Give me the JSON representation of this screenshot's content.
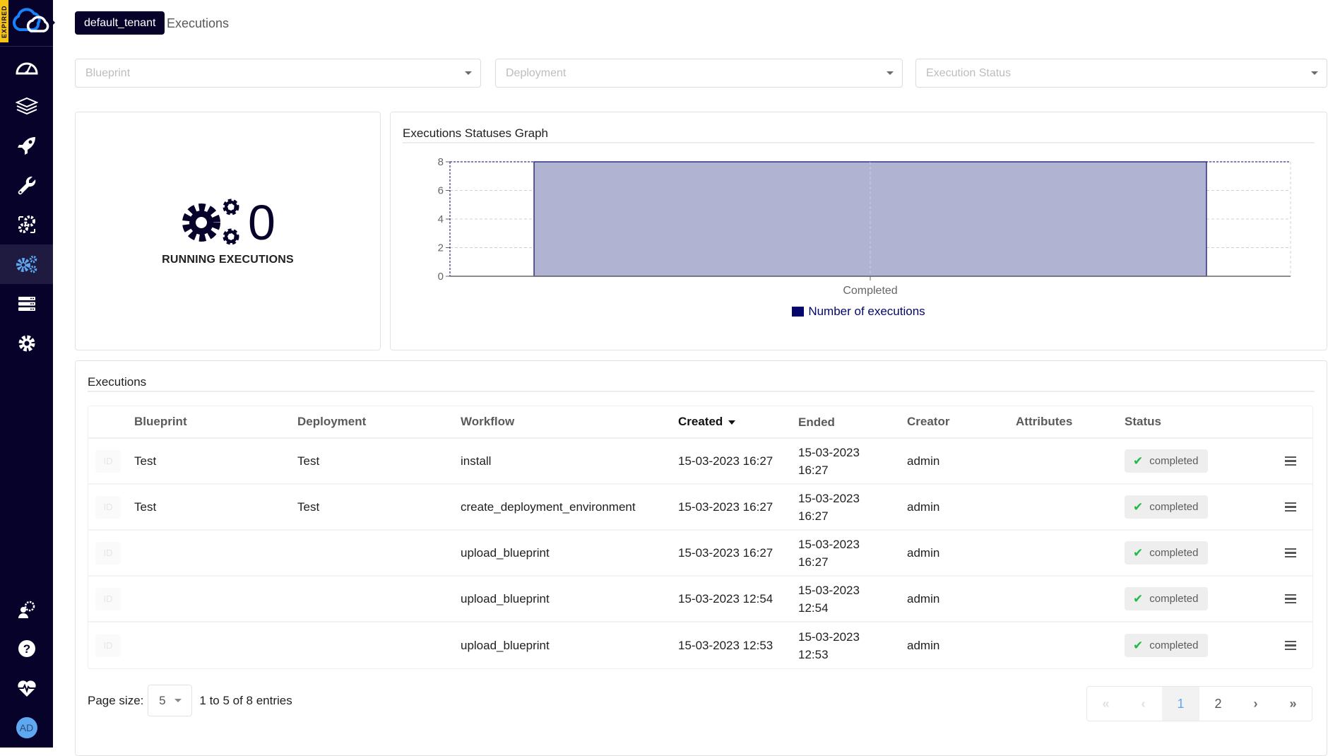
{
  "app": {
    "license_badge": "EXPIRED",
    "tenant": "default_tenant",
    "page_title": "Executions",
    "accent_color": "#5ea8f2",
    "sidebar_bg": "#06022a"
  },
  "sidebar": {
    "items": [
      {
        "name": "dashboard",
        "icon": "dashboard-gauge-icon",
        "active": false
      },
      {
        "name": "blueprints",
        "icon": "layers-icon",
        "active": false
      },
      {
        "name": "deployments",
        "icon": "rocket-icon",
        "active": false
      },
      {
        "name": "tools",
        "icon": "wrench-icon",
        "active": false
      },
      {
        "name": "plugins",
        "icon": "cogs-refresh-icon",
        "active": false
      },
      {
        "name": "executions",
        "icon": "cogs-icon",
        "active": true
      },
      {
        "name": "system-resources",
        "icon": "server-icon",
        "active": false
      },
      {
        "name": "settings",
        "icon": "gear-icon",
        "active": false
      }
    ],
    "bottom_items": [
      {
        "name": "admin-operations",
        "icon": "user-gear-icon"
      },
      {
        "name": "help",
        "icon": "question-circle-icon"
      },
      {
        "name": "health",
        "icon": "heartbeat-icon"
      }
    ],
    "user_initials": "AD"
  },
  "filters": {
    "blueprint_placeholder": "Blueprint",
    "deployment_placeholder": "Deployment",
    "status_placeholder": "Execution Status"
  },
  "running_widget": {
    "count": "0",
    "label": "RUNNING EXECUTIONS"
  },
  "graph_widget": {
    "title": "Executions Statuses Graph"
  },
  "chart_data": {
    "type": "bar",
    "title": "Executions Statuses Graph",
    "categories": [
      "Completed"
    ],
    "series": [
      {
        "name": "Number of executions",
        "values": [
          8
        ],
        "color": "#06066b",
        "fill": "#b1b3d3"
      }
    ],
    "xlabel": "",
    "ylabel": "",
    "ylim": [
      0,
      8
    ],
    "yticks": [
      "0",
      "2",
      "4",
      "6",
      "8"
    ],
    "grid": true,
    "legend": "bottom-center"
  },
  "executions": {
    "title": "Executions",
    "columns": {
      "blueprint": "Blueprint",
      "deployment": "Deployment",
      "workflow": "Workflow",
      "created": "Created",
      "ended": "Ended",
      "creator": "Creator",
      "attributes": "Attributes",
      "status": "Status"
    },
    "sorted_by": "created",
    "id_chip_label": "ID",
    "rows": [
      {
        "blueprint": "Test",
        "deployment": "Test",
        "workflow": "install",
        "created": "15-03-2023 16:27",
        "ended_date": "15-03-2023",
        "ended_time": "16:27",
        "creator": "admin",
        "attributes": "",
        "status": "completed"
      },
      {
        "blueprint": "Test",
        "deployment": "Test",
        "workflow": "create_deployment_environment",
        "created": "15-03-2023 16:27",
        "ended_date": "15-03-2023",
        "ended_time": "16:27",
        "creator": "admin",
        "attributes": "",
        "status": "completed"
      },
      {
        "blueprint": "",
        "deployment": "",
        "workflow": "upload_blueprint",
        "created": "15-03-2023 16:27",
        "ended_date": "15-03-2023",
        "ended_time": "16:27",
        "creator": "admin",
        "attributes": "",
        "status": "completed"
      },
      {
        "blueprint": "",
        "deployment": "",
        "workflow": "upload_blueprint",
        "created": "15-03-2023 12:54",
        "ended_date": "15-03-2023",
        "ended_time": "12:54",
        "creator": "admin",
        "attributes": "",
        "status": "completed"
      },
      {
        "blueprint": "",
        "deployment": "",
        "workflow": "upload_blueprint",
        "created": "15-03-2023 12:53",
        "ended_date": "15-03-2023",
        "ended_time": "12:53",
        "creator": "admin",
        "attributes": "",
        "status": "completed"
      }
    ],
    "pagination": {
      "page_size_label": "Page size:",
      "page_size": "5",
      "summary": "1 to 5 of 8 entries",
      "pages": [
        "1",
        "2"
      ],
      "current_page": "1",
      "first": "«",
      "prev": "‹",
      "next": "›",
      "last": "»"
    }
  }
}
